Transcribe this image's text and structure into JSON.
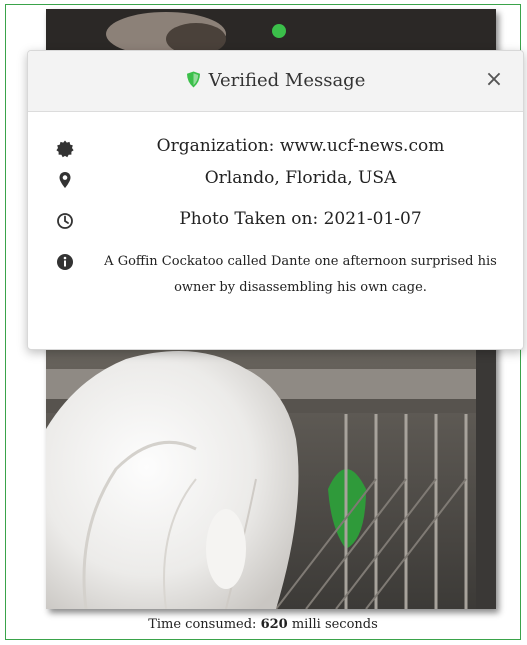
{
  "photo": {
    "alt": "Goffin Cockatoo in cage"
  },
  "caption": {
    "prefix": "Time consumed: ",
    "value": "620",
    "suffix": " milli seconds"
  },
  "modal": {
    "title": "Verified Message",
    "close_label": "×",
    "accent_color": "#3bbf4a",
    "items": [
      {
        "icon": "certificate-icon",
        "text": "Organization: www.ucf-news.com"
      },
      {
        "icon": "map-marker-icon",
        "text": "Orlando, Florida, USA"
      },
      {
        "icon": "clock-icon",
        "text": "Photo Taken on: 2021-01-07"
      },
      {
        "icon": "info-icon",
        "text": "A Goffin Cockatoo called Dante one afternoon surprised his owner by disassembling his own cage."
      }
    ]
  }
}
